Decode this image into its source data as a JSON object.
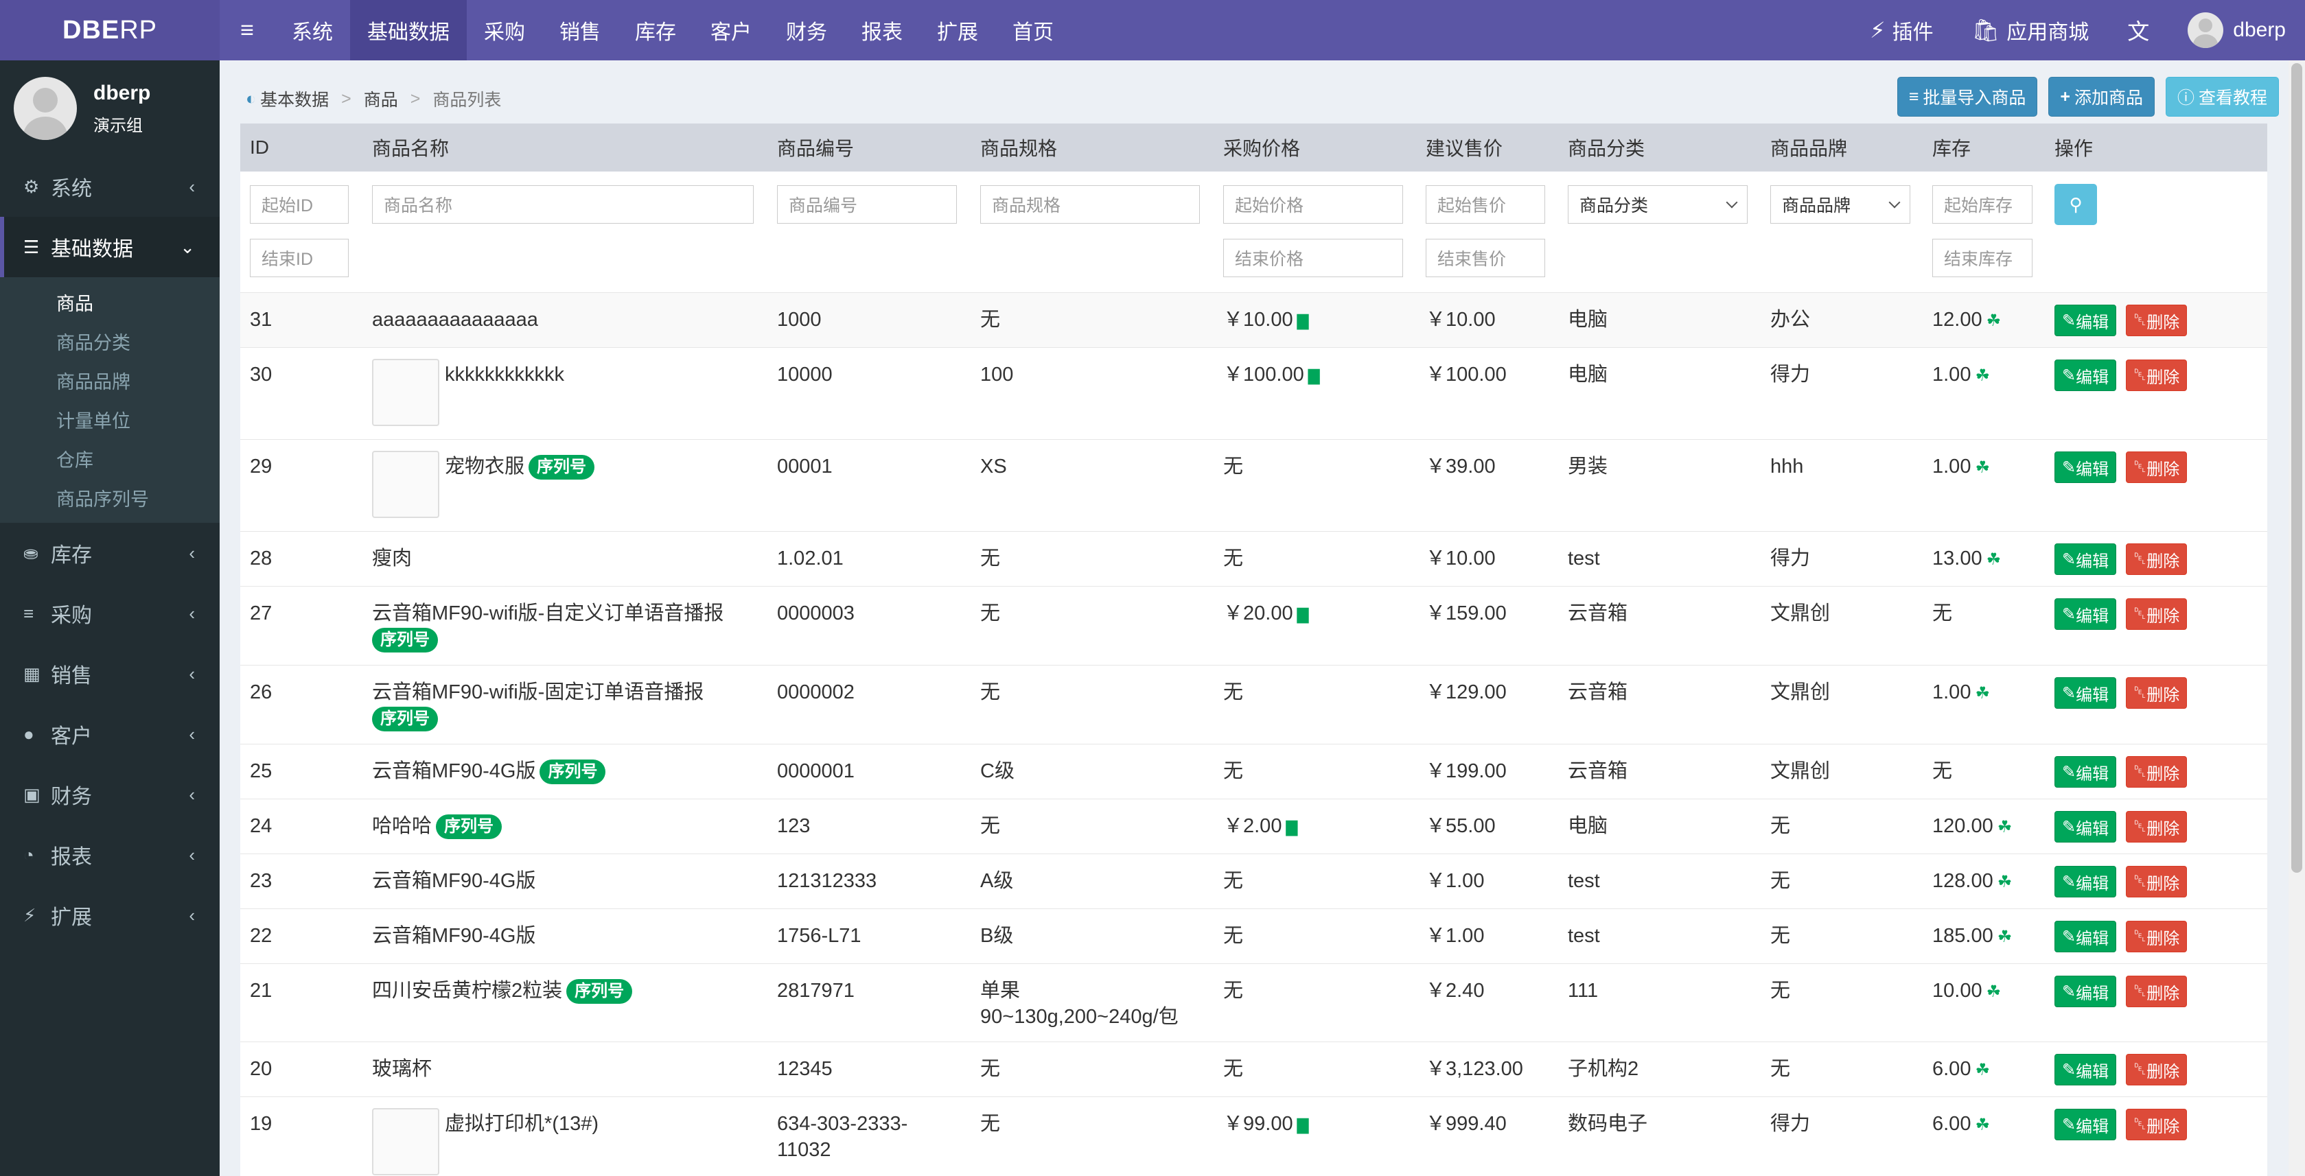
{
  "topbar": {
    "logo_bold": "DBE",
    "logo_thin": "RP",
    "nav": [
      "系统",
      "基础数据",
      "采购",
      "销售",
      "库存",
      "客户",
      "财务",
      "报表",
      "扩展",
      "首页"
    ],
    "plugin": "插件",
    "appstore": "应用商城",
    "username": "dberp"
  },
  "sidebar": {
    "user_name": "dberp",
    "user_group": "演示组",
    "menu": [
      {
        "label": "系统",
        "icon": "gears-icon"
      },
      {
        "label": "基础数据",
        "icon": "database-icon"
      },
      {
        "label": "库存",
        "icon": "cubes-icon"
      },
      {
        "label": "采购",
        "icon": "list-icon"
      },
      {
        "label": "销售",
        "icon": "grid-icon"
      },
      {
        "label": "客户",
        "icon": "user-icon"
      },
      {
        "label": "财务",
        "icon": "money-icon"
      },
      {
        "label": "报表",
        "icon": "pie-chart-icon"
      },
      {
        "label": "扩展",
        "icon": "plug-icon"
      }
    ],
    "submenu": [
      "商品",
      "商品分类",
      "商品品牌",
      "计量单位",
      "仓库",
      "商品序列号"
    ]
  },
  "breadcrumb": [
    "基本数据",
    "商品",
    "商品列表"
  ],
  "buttons": {
    "import": "批量导入商品",
    "add": "添加商品",
    "tutorial": "查看教程"
  },
  "table": {
    "headers": [
      "ID",
      "商品名称",
      "商品编号",
      "商品规格",
      "采购价格",
      "建议售价",
      "商品分类",
      "商品品牌",
      "库存",
      "操作"
    ],
    "filters": {
      "start_id": "起始ID",
      "end_id": "结束ID",
      "name": "商品名称",
      "code": "商品编号",
      "spec": "商品规格",
      "start_price": "起始价格",
      "end_price": "结束价格",
      "start_sale": "起始售价",
      "end_sale": "结束售价",
      "category": "商品分类",
      "brand": "商品品牌",
      "start_stock": "起始库存",
      "end_stock": "结束库存"
    },
    "serial_badge": "序列号",
    "edit": "编辑",
    "delete": "删除",
    "rows": [
      {
        "id": "31",
        "name": "aaaaaaaaaaaaaaa",
        "code": "1000",
        "spec": "无",
        "purchase": "￥10.00",
        "sale": "￥10.00",
        "category": "电脑",
        "brand": "办公",
        "stock": "12.00"
      },
      {
        "id": "30",
        "name": "kkkkkkkkkkkk",
        "code": "10000",
        "spec": "100",
        "purchase": "￥100.00",
        "sale": "￥100.00",
        "category": "电脑",
        "brand": "得力",
        "stock": "1.00"
      },
      {
        "id": "29",
        "name": "宠物衣服",
        "code": "00001",
        "spec": "XS",
        "purchase": "无",
        "sale": "￥39.00",
        "category": "男装",
        "brand": "hhh",
        "stock": "1.00"
      },
      {
        "id": "28",
        "name": "瘦肉",
        "code": "1.02.01",
        "spec": "无",
        "purchase": "无",
        "sale": "￥10.00",
        "category": "test",
        "brand": "得力",
        "stock": "13.00"
      },
      {
        "id": "27",
        "name": "云音箱MF90-wifi版-自定义订单语音播报",
        "code": "0000003",
        "spec": "无",
        "purchase": "￥20.00",
        "sale": "￥159.00",
        "category": "云音箱",
        "brand": "文鼎创",
        "stock": "无"
      },
      {
        "id": "26",
        "name": "云音箱MF90-wifi版-固定订单语音播报",
        "code": "0000002",
        "spec": "无",
        "purchase": "无",
        "sale": "￥129.00",
        "category": "云音箱",
        "brand": "文鼎创",
        "stock": "1.00"
      },
      {
        "id": "25",
        "name": "云音箱MF90-4G版",
        "code": "0000001",
        "spec": "C级",
        "purchase": "无",
        "sale": "￥199.00",
        "category": "云音箱",
        "brand": "文鼎创",
        "stock": "无"
      },
      {
        "id": "24",
        "name": "哈哈哈",
        "code": "123",
        "spec": "无",
        "purchase": "￥2.00",
        "sale": "￥55.00",
        "category": "电脑",
        "brand": "无",
        "stock": "120.00"
      },
      {
        "id": "23",
        "name": "云音箱MF90-4G版",
        "code": "121312333",
        "spec": "A级",
        "purchase": "无",
        "sale": "￥1.00",
        "category": "test",
        "brand": "无",
        "stock": "128.00"
      },
      {
        "id": "22",
        "name": "云音箱MF90-4G版",
        "code": "1756-L71",
        "spec": "B级",
        "purchase": "无",
        "sale": "￥1.00",
        "category": "test",
        "brand": "无",
        "stock": "185.00"
      },
      {
        "id": "21",
        "name": "四川安岳黄柠檬2粒装",
        "code": "2817971",
        "spec_line1": "单果",
        "spec_line2": "90~130g,200~240g/包",
        "purchase": "无",
        "sale": "￥2.40",
        "category": "111",
        "brand": "无",
        "stock": "10.00"
      },
      {
        "id": "20",
        "name": "玻璃杯",
        "code": "12345",
        "spec": "无",
        "purchase": "无",
        "sale": "￥3,123.00",
        "category": "子机构2",
        "brand": "无",
        "stock": "6.00"
      },
      {
        "id": "19",
        "name": "虚拟打印机*(13#)",
        "code_line1": "634-303-2333-",
        "code_line2": "11032",
        "spec": "无",
        "purchase": "￥99.00",
        "sale": "￥999.40",
        "category": "数码电子",
        "brand": "得力",
        "stock": "6.00"
      }
    ]
  }
}
